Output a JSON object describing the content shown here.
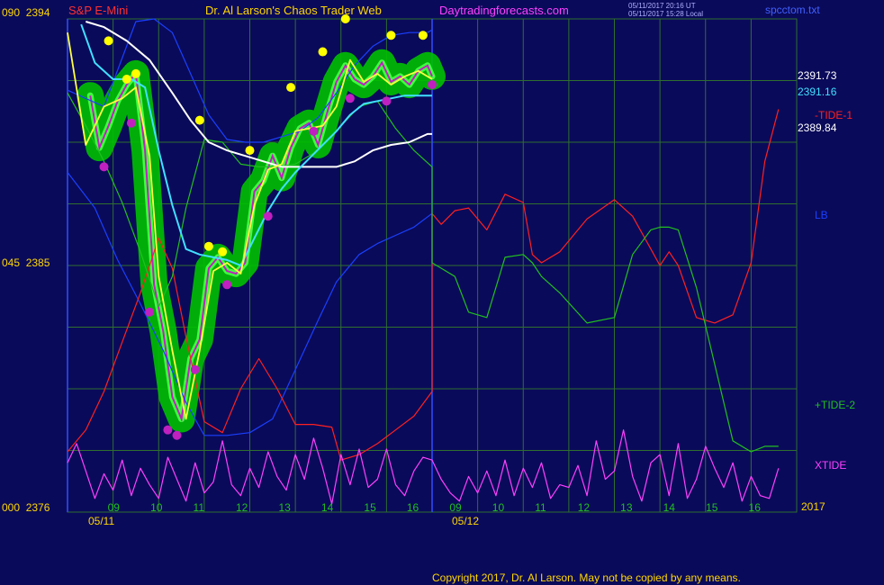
{
  "header": {
    "instrument": "S&P E-Mini",
    "site": "Dr. Al Larson's Chaos Trader Web",
    "url": "Daytradingforecasts.com",
    "stamp_line1": "05/11/2017 20:16 UT",
    "stamp_line2": "05/11/2017 15:28 Local",
    "file": "spcctom.txt"
  },
  "footer": {
    "copyright": "Copyright 2017, Dr. Al Larson. May not be copied by any means.",
    "year": "2017"
  },
  "colors": {
    "background": "#0a0a5a",
    "grid": "#2f6f2f",
    "price_band": "#00c000",
    "price_bars": "#40ff40",
    "fast_avg": "#ffff40",
    "mid_avg": "#40e0ff",
    "slow_avg": "#ffffff",
    "bands": "#1a40ff",
    "tide1": "#ff2020",
    "tide2": "#20c020",
    "xtide": "#ff40ff",
    "highs": "#ffff00",
    "lows": "#c020c0"
  },
  "chart_data": {
    "type": "line",
    "title": "S&P E-Mini",
    "y_axis": {
      "min": 2376,
      "max": 2394,
      "tick_labels": [
        {
          "value": 2394,
          "label": "090  2394"
        },
        {
          "value": 2385,
          "label": "045  2385"
        },
        {
          "value": 2376,
          "label": "000  2376"
        }
      ]
    },
    "x_axis": {
      "hour_ticks": [
        "09",
        "10",
        "11",
        "12",
        "13",
        "14",
        "15",
        "16",
        "09",
        "10",
        "11",
        "12",
        "13",
        "14",
        "15",
        "16"
      ],
      "date_labels": [
        "05/11",
        "05/12"
      ]
    },
    "price_labels": [
      {
        "value": "2391.73",
        "color": "#ffffff"
      },
      {
        "value": "2391.16",
        "color": "#40e0ff"
      },
      {
        "value": "2389.84",
        "color": "#ffffff"
      }
    ],
    "series_labels": [
      {
        "name": "-TIDE-1",
        "color": "#ff2020"
      },
      {
        "name": "LB",
        "color": "#1a40ff"
      },
      {
        "name": "+TIDE-2",
        "color": "#20c020"
      },
      {
        "name": "XTIDE",
        "color": "#ff40ff"
      }
    ],
    "price_series": {
      "x": [
        8.5,
        8.7,
        8.9,
        9.1,
        9.3,
        9.5,
        9.7,
        9.9,
        10.1,
        10.3,
        10.5,
        10.7,
        10.9,
        11.1,
        11.3,
        11.5,
        11.7,
        11.9,
        12.1,
        12.3,
        12.5,
        12.7,
        12.9,
        13.1,
        13.3,
        13.5,
        13.7,
        13.9,
        14.1,
        14.3,
        14.5,
        14.7,
        14.9,
        15.1,
        15.3,
        15.5,
        15.7,
        15.9,
        16.0
      ],
      "close": [
        2391.2,
        2389.3,
        2390.1,
        2391.0,
        2391.6,
        2392.0,
        2389.2,
        2384.3,
        2382.6,
        2380.2,
        2379.4,
        2381.6,
        2382.3,
        2384.9,
        2385.3,
        2384.8,
        2384.7,
        2385.1,
        2387.7,
        2388.1,
        2389.0,
        2388.2,
        2389.3,
        2390.0,
        2390.2,
        2389.4,
        2390.6,
        2391.7,
        2392.3,
        2391.8,
        2391.6,
        2391.9,
        2392.4,
        2391.7,
        2391.9,
        2391.6,
        2392.1,
        2392.3,
        2391.9
      ]
    },
    "fast_avg": {
      "x": [
        8.0,
        8.4,
        8.8,
        9.2,
        9.5,
        9.8,
        10.0,
        10.3,
        10.6,
        10.9,
        11.2,
        11.5,
        11.8,
        12.1,
        12.4,
        12.7,
        13.0,
        13.3,
        13.6,
        13.9,
        14.2,
        14.5,
        14.8,
        15.1,
        15.4,
        15.7,
        16.0
      ],
      "y": [
        2393.5,
        2389.4,
        2390.8,
        2391.1,
        2391.5,
        2389.0,
        2384.6,
        2381.9,
        2379.4,
        2381.9,
        2384.8,
        2385.1,
        2384.7,
        2387.2,
        2388.5,
        2388.7,
        2389.9,
        2390.0,
        2390.1,
        2390.8,
        2392.5,
        2391.7,
        2392.0,
        2391.6,
        2391.9,
        2392.1,
        2391.8
      ]
    },
    "mid_avg": {
      "x": [
        8.3,
        8.6,
        9.0,
        9.4,
        9.7,
        10.0,
        10.3,
        10.6,
        10.9,
        11.2,
        11.5,
        11.8,
        12.1,
        12.4,
        12.7,
        13.0,
        13.3,
        13.6,
        13.9,
        14.2,
        14.5,
        14.8,
        15.1,
        15.4,
        15.7,
        16.0
      ],
      "y": [
        2393.8,
        2392.4,
        2391.8,
        2391.8,
        2391.5,
        2389.2,
        2387.2,
        2385.6,
        2385.4,
        2385.3,
        2385.2,
        2385.0,
        2386.0,
        2387.0,
        2387.8,
        2388.4,
        2388.9,
        2389.4,
        2389.9,
        2390.5,
        2390.9,
        2391.0,
        2391.1,
        2391.2,
        2391.2,
        2391.2
      ]
    },
    "slow_avg": {
      "x": [
        8.4,
        8.8,
        9.3,
        9.8,
        10.3,
        10.7,
        11.1,
        11.5,
        11.9,
        12.3,
        12.7,
        13.1,
        13.5,
        13.9,
        14.3,
        14.7,
        15.1,
        15.5,
        15.9,
        16.0
      ],
      "y": [
        2393.9,
        2393.7,
        2393.2,
        2392.5,
        2391.3,
        2390.3,
        2389.5,
        2389.2,
        2389.0,
        2388.8,
        2388.6,
        2388.6,
        2388.6,
        2388.6,
        2388.8,
        2389.2,
        2389.4,
        2389.5,
        2389.8,
        2389.8
      ]
    },
    "upper_band": {
      "x": [
        8.0,
        8.8,
        9.5,
        9.9,
        10.3,
        10.7,
        11.1,
        11.5,
        11.9,
        12.3,
        12.7,
        13.1,
        13.5,
        13.9,
        14.3,
        14.7,
        15.1,
        15.5,
        15.9,
        16.0
      ],
      "y": [
        2391.4,
        2390.8,
        2393.9,
        2394.0,
        2393.5,
        2392.0,
        2390.5,
        2389.6,
        2389.5,
        2389.5,
        2389.7,
        2389.9,
        2390.4,
        2391.3,
        2392.3,
        2393.0,
        2393.4,
        2393.5,
        2393.5,
        2393.6
      ]
    },
    "lower_band": {
      "x": [
        8.0,
        8.6,
        9.1,
        9.6,
        10.1,
        10.6,
        11.0,
        11.5,
        12.0,
        12.5,
        13.0,
        13.5,
        13.9,
        14.4,
        14.8,
        15.2,
        15.6,
        16.0
      ],
      "y": [
        2388.4,
        2387.1,
        2385.2,
        2383.6,
        2381.9,
        2380.0,
        2378.8,
        2378.8,
        2378.9,
        2379.4,
        2381.2,
        2383.0,
        2384.4,
        2385.4,
        2385.8,
        2386.1,
        2386.4,
        2386.9
      ]
    },
    "tide1": {
      "x": [
        8.0,
        8.4,
        8.8,
        9.2,
        9.6,
        10.0,
        10.3,
        10.6,
        11.0,
        11.4,
        11.8,
        12.2,
        12.6,
        13.0,
        13.4,
        13.8,
        14.0,
        14.4,
        14.8,
        15.2,
        15.6,
        16.0,
        16.0,
        16.2,
        16.5,
        16.8,
        17.2,
        17.6,
        18.0,
        18.2,
        18.4,
        18.8,
        19.4,
        20.0,
        20.4,
        20.8,
        21.0,
        21.2,
        21.4,
        21.8,
        22.2,
        22.6,
        23.0,
        23.3,
        23.6
      ],
      "y": [
        2378.2,
        2379.0,
        2380.4,
        2382.2,
        2384.0,
        2386.0,
        2384.9,
        2382.4,
        2379.3,
        2378.9,
        2380.5,
        2381.6,
        2380.5,
        2379.2,
        2379.2,
        2379.1,
        2377.9,
        2378.1,
        2378.5,
        2379.0,
        2379.5,
        2380.4,
        2386.9,
        2386.5,
        2387.0,
        2387.1,
        2386.3,
        2387.6,
        2387.3,
        2385.4,
        2385.1,
        2385.5,
        2386.7,
        2387.4,
        2386.8,
        2385.6,
        2385.0,
        2385.5,
        2385.0,
        2383.1,
        2382.9,
        2383.2,
        2385.1,
        2388.8,
        2390.7
      ]
    },
    "tide2": {
      "x": [
        8.0,
        8.4,
        8.8,
        9.2,
        9.6,
        10.0,
        10.3,
        10.6,
        11.0,
        11.4,
        11.8,
        12.2,
        12.6,
        13.0,
        13.4,
        13.8,
        14.0,
        14.4,
        14.8,
        15.2,
        15.6,
        16.0,
        16.0,
        16.2,
        16.5,
        16.8,
        17.2,
        17.6,
        18.0,
        18.2,
        18.4,
        18.8,
        19.4,
        20.0,
        20.4,
        20.8,
        21.0,
        21.2,
        21.4,
        21.8,
        22.2,
        22.6,
        23.0,
        23.3,
        23.6
      ],
      "y": [
        2391.3,
        2390.1,
        2388.8,
        2387.3,
        2385.5,
        2383.5,
        2384.6,
        2387.1,
        2389.6,
        2389.5,
        2388.7,
        2388.6,
        2388.6,
        2388.7,
        2389.1,
        2389.7,
        2390.1,
        2390.8,
        2391.0,
        2390.0,
        2389.2,
        2388.6,
        2385.1,
        2384.9,
        2384.6,
        2383.3,
        2383.1,
        2385.3,
        2385.4,
        2385.1,
        2384.6,
        2384.0,
        2382.9,
        2383.1,
        2385.4,
        2386.3,
        2386.4,
        2386.4,
        2386.3,
        2384.2,
        2381.4,
        2378.6,
        2378.2,
        2378.4,
        2378.4
      ]
    },
    "xtide": {
      "x": [
        8.0,
        8.2,
        8.4,
        8.6,
        8.8,
        9.0,
        9.2,
        9.4,
        9.6,
        9.8,
        10.0,
        10.2,
        10.4,
        10.6,
        10.8,
        11.0,
        11.2,
        11.4,
        11.6,
        11.8,
        12.0,
        12.2,
        12.4,
        12.6,
        12.8,
        13.0,
        13.2,
        13.4,
        13.6,
        13.8,
        14.0,
        14.2,
        14.4,
        14.6,
        14.8,
        15.0,
        15.2,
        15.4,
        15.6,
        15.8,
        16.0,
        16.2,
        16.4,
        16.6,
        16.8,
        17.0,
        17.2,
        17.4,
        17.6,
        17.8,
        18.0,
        18.2,
        18.4,
        18.6,
        18.8,
        19.0,
        19.2,
        19.4,
        19.6,
        19.8,
        20.0,
        20.2,
        20.4,
        20.6,
        20.8,
        21.0,
        21.2,
        21.4,
        21.6,
        21.8,
        22.0,
        22.2,
        22.4,
        22.6,
        22.8,
        23.0,
        23.2,
        23.4,
        23.6
      ],
      "y": [
        2377.8,
        2378.5,
        2377.5,
        2376.5,
        2377.4,
        2376.8,
        2377.9,
        2376.6,
        2377.6,
        2377.0,
        2376.5,
        2378.0,
        2377.2,
        2376.4,
        2377.8,
        2376.7,
        2377.1,
        2378.6,
        2377.0,
        2376.6,
        2377.6,
        2376.9,
        2378.2,
        2377.3,
        2376.8,
        2378.1,
        2377.2,
        2378.7,
        2377.6,
        2376.3,
        2378.1,
        2377.0,
        2378.3,
        2376.9,
        2377.2,
        2378.3,
        2377.0,
        2376.6,
        2377.5,
        2378.0,
        2377.9,
        2377.2,
        2376.7,
        2376.4,
        2377.3,
        2376.7,
        2377.5,
        2376.6,
        2377.9,
        2376.6,
        2377.6,
        2376.9,
        2377.8,
        2376.5,
        2377.0,
        2376.9,
        2377.7,
        2376.6,
        2378.6,
        2377.2,
        2377.5,
        2379.0,
        2377.3,
        2376.4,
        2377.8,
        2378.1,
        2376.6,
        2378.5,
        2376.5,
        2377.2,
        2378.4,
        2377.6,
        2376.9,
        2377.8,
        2376.4,
        2377.3,
        2376.6,
        2376.5,
        2377.6
      ]
    },
    "turning_highs": [
      2393.2,
      2391.8,
      2392.0,
      2390.3,
      2385.7,
      2385.5,
      2389.2,
      2391.5,
      2392.8,
      2394.0,
      2393.4,
      2393.4
    ],
    "turning_lows": [
      2388.6,
      2390.2,
      2383.3,
      2379.0,
      2378.8,
      2381.2,
      2384.3,
      2386.8,
      2389.9,
      2391.1,
      2391.0,
      2391.6
    ]
  }
}
